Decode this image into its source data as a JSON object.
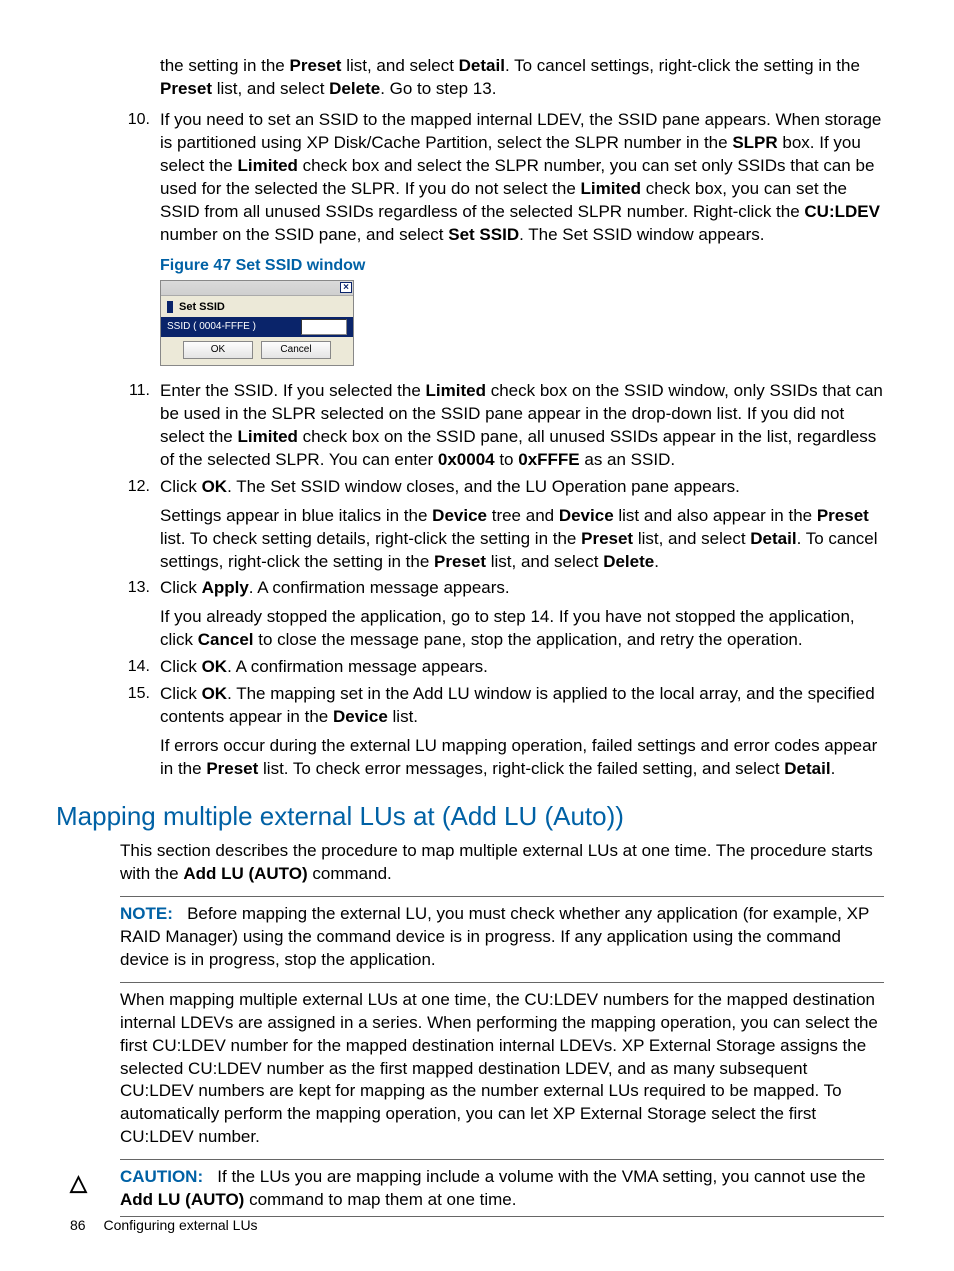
{
  "items": {
    "pre9": {
      "p1_seg1": "the setting in the ",
      "p1_b1": "Preset",
      "p1_seg2": " list, and select ",
      "p1_b2": "Detail",
      "p1_seg3": ". To cancel settings, right-click the setting in the ",
      "p1_b3": "Preset",
      "p1_seg4": " list, and select ",
      "p1_b4": "Delete",
      "p1_seg5": ". Go to step 13."
    },
    "n10": {
      "num": "10.",
      "seg1": "If you need to set an SSID to the mapped internal LDEV, the SSID pane appears. When storage is partitioned using XP Disk/Cache Partition, select the SLPR number in the ",
      "b1": "SLPR",
      "seg2": " box. If you select the ",
      "b2": "Limited",
      "seg3": " check box and select the SLPR number, you can set only SSIDs that can be used for the selected the SLPR. If you do not select the ",
      "b3": "Limited",
      "seg4": " check box, you can set the SSID from all unused SSIDs regardless of the selected SLPR number. Right-click the ",
      "b4": "CU:LDEV",
      "seg5": " number on the SSID pane, and select ",
      "b5": "Set SSID",
      "seg6": ". The Set SSID window appears."
    },
    "figcap": "Figure 47 Set SSID window",
    "ssid": {
      "title": "Set SSID",
      "label": "SSID ( 0004-FFFE )",
      "ok": "OK",
      "cancel": "Cancel",
      "close": "×"
    },
    "n11": {
      "num": "11.",
      "seg1": "Enter the SSID. If you selected the ",
      "b1": "Limited",
      "seg2": " check box on the SSID window, only SSIDs that can be used in the SLPR selected on the SSID pane appear in the drop-down list. If you did not select the ",
      "b2": "Limited",
      "seg3": " check box on the SSID pane, all unused SSIDs appear in the list, regardless of the selected SLPR. You can enter ",
      "b3": "0x0004",
      "seg4": " to ",
      "b4": "0xFFFE",
      "seg5": " as an SSID."
    },
    "n12": {
      "num": "12.",
      "p1_seg1": "Click ",
      "p1_b1": "OK",
      "p1_seg2": ". The Set SSID window closes, and the LU Operation pane appears.",
      "p2_seg1": "Settings appear in blue italics in the ",
      "p2_b1": "Device",
      "p2_seg2": " tree and ",
      "p2_b2": "Device",
      "p2_seg3": " list and also appear in the ",
      "p2_b3": "Preset",
      "p2_seg4": " list. To check setting details, right-click the setting in the ",
      "p2_b4": "Preset",
      "p2_seg5": " list, and select ",
      "p2_b5": "Detail",
      "p2_seg6": ". To cancel settings, right-click the setting in the ",
      "p2_b6": "Preset",
      "p2_seg7": " list, and select ",
      "p2_b7": "Delete",
      "p2_seg8": "."
    },
    "n13": {
      "num": "13.",
      "p1_seg1": "Click ",
      "p1_b1": "Apply",
      "p1_seg2": ". A confirmation message appears.",
      "p2_seg1": "If you already stopped the application, go to step 14. If you have not stopped the application, click ",
      "p2_b1": "Cancel",
      "p2_seg2": " to close the message pane, stop the application, and retry the operation."
    },
    "n14": {
      "num": "14.",
      "seg1": "Click ",
      "b1": "OK",
      "seg2": ". A confirmation message appears."
    },
    "n15": {
      "num": "15.",
      "p1_seg1": "Click ",
      "p1_b1": "OK",
      "p1_seg2": ". The mapping set in the Add LU window is applied to the local array, and the specified contents appear in the ",
      "p1_b2": "Device",
      "p1_seg3": " list.",
      "p2_seg1": "If errors occur during the external LU mapping operation, failed settings and error codes appear in the ",
      "p2_b1": "Preset",
      "p2_seg2": " list. To check error messages, right-click the failed setting, and select ",
      "p2_b2": "Detail",
      "p2_seg3": "."
    }
  },
  "section_heading": "Mapping multiple external LUs at (Add LU (Auto))",
  "section_p1_seg1": "This section describes the procedure to map multiple external LUs at one time. The procedure starts with the ",
  "section_p1_b1": "Add LU (AUTO)",
  "section_p1_seg2": " command.",
  "note_label": "NOTE:",
  "note_text": "Before mapping the external LU, you must check whether any application (for example, XP RAID Manager) using the command device is in progress. If any application using the command device is in progress, stop the application.",
  "section_p2": "When mapping multiple external LUs at one time, the CU:LDEV numbers for the mapped destination internal LDEVs are assigned in a series. When performing the mapping operation, you can select the first CU:LDEV number for the mapped destination internal LDEVs. XP External Storage assigns the selected CU:LDEV number as the first mapped destination LDEV, and as many subsequent CU:LDEV numbers are kept for mapping as the number external LUs required to be mapped. To automatically perform the mapping operation, you can let XP External Storage select the first CU:LDEV number.",
  "caution_icon": "△",
  "caution_label": "CAUTION:",
  "caution_seg1": "If the LUs you are mapping include a volume with the VMA setting, you cannot use the ",
  "caution_b1": "Add LU (AUTO)",
  "caution_seg2": " command to map them at one time.",
  "footer_page": "86",
  "footer_title": "Configuring external LUs"
}
